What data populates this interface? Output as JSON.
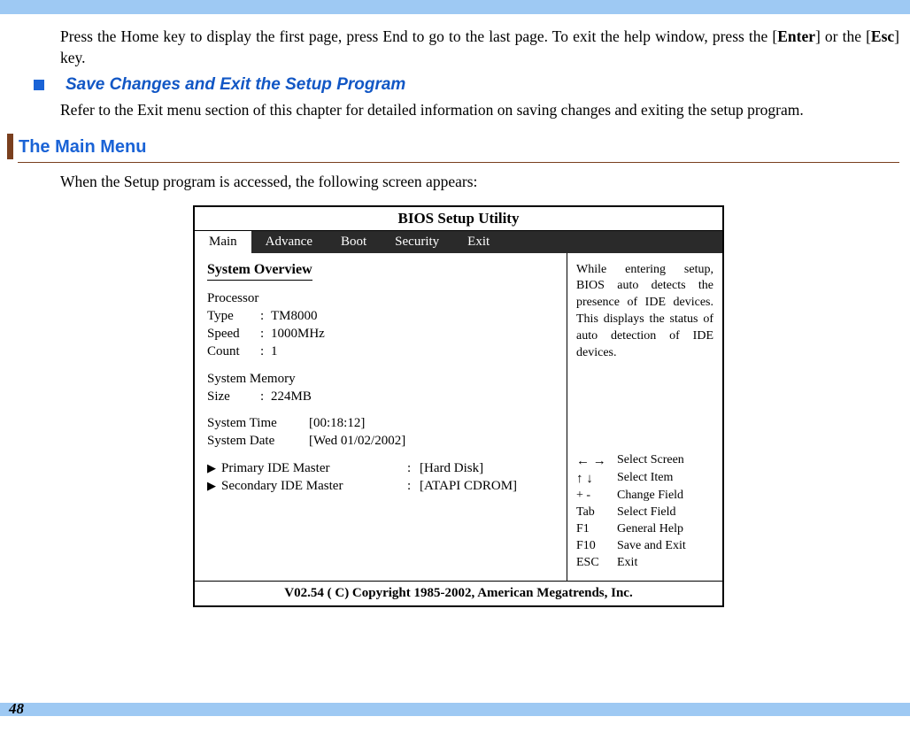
{
  "intro_para": "Press the Home key to display the first page, press End to go to the last page. To exit the help window, press the [Enter] or the [Esc] key.",
  "subheading": "Save Changes and Exit the Setup Program",
  "sub_para": "Refer to the Exit menu section of this chapter for detailed information on saving changes and exiting the setup program.",
  "section_title": "The Main Menu",
  "section_para": "When the Setup program is accessed, the following screen appears:",
  "bios": {
    "title": "BIOS Setup Utility",
    "tabs": {
      "main": "Main",
      "advance": "Advance",
      "boot": "Boot",
      "security": "Security",
      "exit": "Exit"
    },
    "overview_heading": "System Overview",
    "processor": {
      "heading": "Processor",
      "type_label": "Type",
      "type_value": "TM8000",
      "speed_label": "Speed",
      "speed_value": "1000MHz",
      "count_label": "Count",
      "count_value": "1"
    },
    "memory": {
      "heading": "System Memory",
      "size_label": "Size",
      "size_value": "224MB"
    },
    "time": {
      "time_label": "System Time",
      "time_value": "[00:18:12]",
      "date_label": "System Date",
      "date_value": "[Wed 01/02/2002]"
    },
    "ide": {
      "primary_label": "Primary IDE Master",
      "primary_value": "[Hard Disk]",
      "secondary_label": "Secondary IDE Master",
      "secondary_value": "[ATAPI CDROM]"
    },
    "help_text": "While entering setup, BIOS auto detects the presence of IDE devices. This displays the status of auto detection of IDE devices.",
    "keys": {
      "screen_sym": "← →",
      "screen": "Select Screen",
      "item_sym": "↑ ↓",
      "item": "Select Item",
      "change_sym": "+ -",
      "change": "Change Field",
      "tab_sym": "Tab",
      "tab": "Select Field",
      "f1_sym": "F1",
      "f1": "General Help",
      "f10_sym": "F10",
      "f10": "Save and Exit",
      "esc_sym": "ESC",
      "esc": "Exit"
    },
    "footer": "V02.54  ( C) Copyright 1985-2002, American Megatrends, Inc."
  },
  "page_number": "48"
}
